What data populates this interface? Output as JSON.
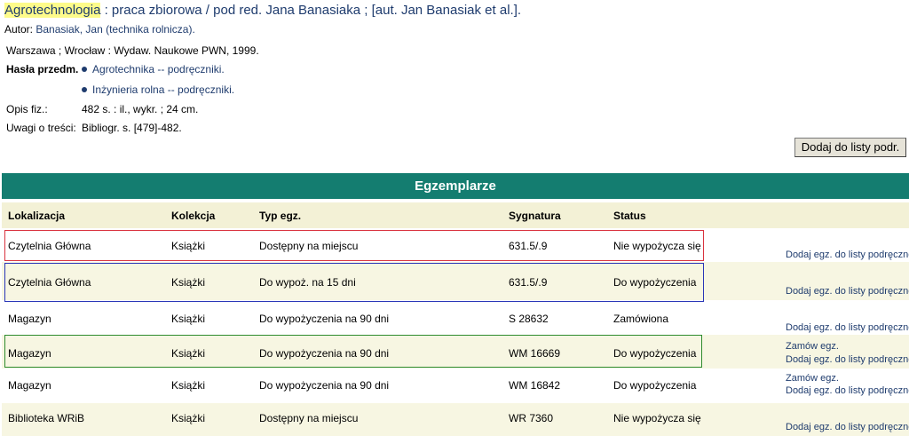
{
  "record": {
    "title_main": "Agrotechnologia",
    "title_rest": " : praca zbiorowa / pod red. Jana Banasiaka ; [aut. Jan Banasiak et al.].",
    "author_label": "Autor: ",
    "author_link": "Banasiak, Jan (technika rolnicza).",
    "publication": "Warszawa ; Wrocław : Wydaw. Naukowe PWN, 1999.",
    "subjects_label": "Hasła przedm.",
    "subjects": [
      "Agrotechnika -- podręczniki.",
      "Inżynieria rolna -- podręczniki."
    ],
    "physical_label": "Opis fiz.:",
    "physical": "482 s. : il., wykr. ; 24 cm.",
    "notes_label": "Uwagi o treści:",
    "notes": "Bibliogr. s. [479]-482."
  },
  "add_to_list_button": "Dodaj do listy podr.",
  "copies": {
    "header": "Egzemplarze",
    "columns": [
      "Lokalizacja",
      "Kolekcja",
      "Typ egz.",
      "Sygnatura",
      "Status"
    ],
    "rows": [
      {
        "location": "Czytelnia Główna",
        "collection": "Książki",
        "type": "Dostępny na miejscu",
        "signature": "631.5/.9",
        "status": "Nie wypożycza się",
        "actions": [
          "Dodaj egz. do listy podręcznej"
        ]
      },
      {
        "location": "Czytelnia Główna",
        "collection": "Książki",
        "type": "Do wypoż. na 15 dni",
        "signature": "631.5/.9",
        "status": "Do wypożyczenia",
        "actions": [
          "Dodaj egz. do listy podręcznej"
        ]
      },
      {
        "location": "Magazyn",
        "collection": "Książki",
        "type": "Do wypożyczenia na 90 dni",
        "signature": "S 28632",
        "status": "Zamówiona",
        "actions": [
          "Dodaj egz. do listy podręcznej"
        ]
      },
      {
        "location": "Magazyn",
        "collection": "Książki",
        "type": "Do wypożyczenia na 90 dni",
        "signature": "WM 16669",
        "status": "Do wypożyczenia",
        "actions": [
          "Zamów egz.",
          "Dodaj egz. do listy podręcznej"
        ]
      },
      {
        "location": "Magazyn",
        "collection": "Książki",
        "type": "Do wypożyczenia na 90 dni",
        "signature": "WM 16842",
        "status": "Do wypożyczenia",
        "actions": [
          "Zamów egz.",
          "Dodaj egz. do listy podręcznej"
        ]
      },
      {
        "location": "Biblioteka WRiB",
        "collection": "Książki",
        "type": "Dostępny na miejscu",
        "signature": "WR 7360",
        "status": "Nie wypożycza się",
        "actions": [
          "Dodaj egz. do listy podręcznej"
        ]
      }
    ]
  },
  "colors": {
    "header_bg": "#147d70",
    "highlight_red": "#d9333f",
    "highlight_blue": "#2a36b8",
    "highlight_green": "#2e8b2e",
    "link": "#1f3c6e"
  }
}
